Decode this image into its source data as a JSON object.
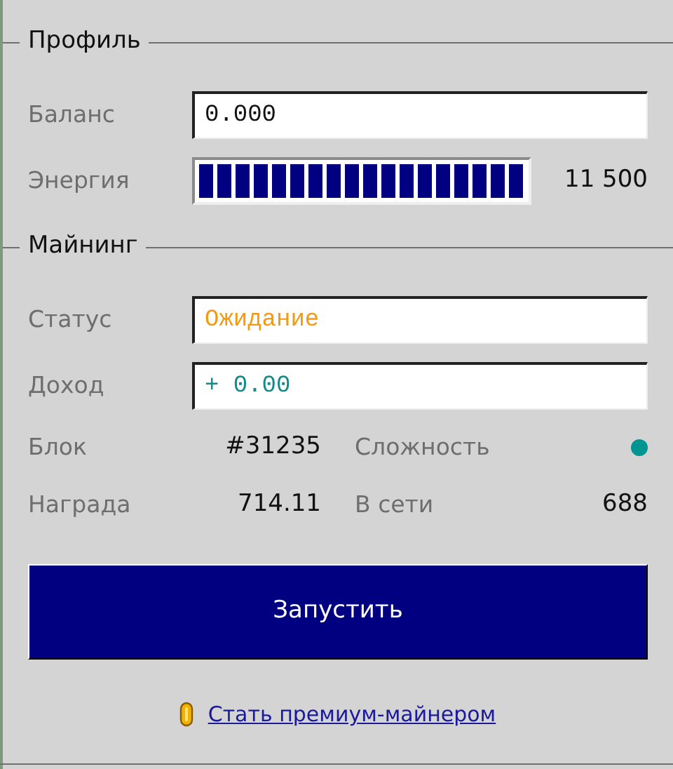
{
  "sections": [
    {
      "title": "Профиль",
      "fields": [
        {
          "kind": "text",
          "label": "Баланс",
          "value": "0.000"
        },
        {
          "kind": "meter",
          "label": "Энергия",
          "level": 1,
          "reading": "11 500"
        }
      ]
    },
    {
      "title": "Майнинг",
      "fields": [
        {
          "kind": "status",
          "label": "Статус",
          "value": "Ожидание"
        },
        {
          "kind": "income",
          "label": "Доход",
          "value": "+ 0.00"
        }
      ],
      "stats": [
        [
          {
            "label": "Блок",
            "value": "#31235"
          },
          {
            "label": "Сложность",
            "color": "#009590"
          }
        ],
        [
          {
            "label": "Награда",
            "value": "714.11"
          },
          {
            "label": "В сети",
            "value": "688"
          }
        ]
      ]
    }
  ],
  "start_button": "Запустить",
  "premium_link": "Стать премиум-майнером"
}
